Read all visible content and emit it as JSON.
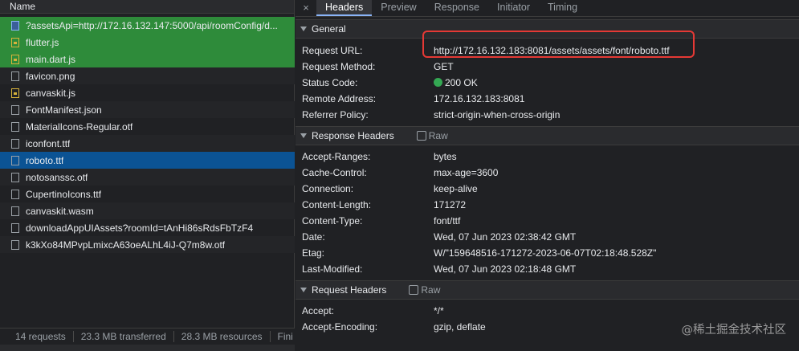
{
  "left": {
    "header": "Name",
    "requests": [
      {
        "name": "?assetsApi=http://172.16.132.147:5000/api/roomConfig/d...",
        "icon": "doc",
        "state": "green"
      },
      {
        "name": "flutter.js",
        "icon": "js",
        "state": "green"
      },
      {
        "name": "main.dart.js",
        "icon": "js",
        "state": "green"
      },
      {
        "name": "favicon.png",
        "icon": "file",
        "state": ""
      },
      {
        "name": "canvaskit.js",
        "icon": "js",
        "state": ""
      },
      {
        "name": "FontManifest.json",
        "icon": "file",
        "state": ""
      },
      {
        "name": "MaterialIcons-Regular.otf",
        "icon": "file",
        "state": ""
      },
      {
        "name": "iconfont.ttf",
        "icon": "file",
        "state": ""
      },
      {
        "name": "roboto.ttf",
        "icon": "file",
        "state": "selected"
      },
      {
        "name": "notosanssc.otf",
        "icon": "file",
        "state": ""
      },
      {
        "name": "CupertinoIcons.ttf",
        "icon": "file",
        "state": ""
      },
      {
        "name": "canvaskit.wasm",
        "icon": "file",
        "state": ""
      },
      {
        "name": "downloadAppUIAssets?roomId=tAnHi86sRdsFbTzF4",
        "icon": "file",
        "state": ""
      },
      {
        "name": "k3kXo84MPvpLmixcA63oeALhL4iJ-Q7m8w.otf",
        "icon": "file",
        "state": ""
      }
    ],
    "status": {
      "requests": "14 requests",
      "transferred": "23.3 MB transferred",
      "resources": "28.3 MB resources",
      "finish": "Fini"
    }
  },
  "tabs": {
    "close": "×",
    "items": [
      "Headers",
      "Preview",
      "Response",
      "Initiator",
      "Timing"
    ],
    "active": "Headers"
  },
  "general": {
    "title": "General",
    "rows": [
      {
        "k": "Request URL:",
        "v": "http://172.16.132.183:8081/assets/assets/font/roboto.ttf"
      },
      {
        "k": "Request Method:",
        "v": "GET"
      },
      {
        "k": "Status Code:",
        "v": "200 OK"
      },
      {
        "k": "Remote Address:",
        "v": "172.16.132.183:8081"
      },
      {
        "k": "Referrer Policy:",
        "v": "strict-origin-when-cross-origin"
      }
    ]
  },
  "response_headers": {
    "title": "Response Headers",
    "raw": "Raw",
    "rows": [
      {
        "k": "Accept-Ranges:",
        "v": "bytes"
      },
      {
        "k": "Cache-Control:",
        "v": "max-age=3600"
      },
      {
        "k": "Connection:",
        "v": "keep-alive"
      },
      {
        "k": "Content-Length:",
        "v": "171272"
      },
      {
        "k": "Content-Type:",
        "v": "font/ttf"
      },
      {
        "k": "Date:",
        "v": "Wed, 07 Jun 2023 02:38:42 GMT"
      },
      {
        "k": "Etag:",
        "v": "W/\"159648516-171272-2023-06-07T02:18:48.528Z\""
      },
      {
        "k": "Last-Modified:",
        "v": "Wed, 07 Jun 2023 02:18:48 GMT"
      }
    ]
  },
  "request_headers": {
    "title": "Request Headers",
    "raw": "Raw",
    "rows": [
      {
        "k": "Accept:",
        "v": "*/*"
      },
      {
        "k": "Accept-Encoding:",
        "v": "gzip, deflate"
      }
    ]
  },
  "watermark": "@稀土掘金技术社区",
  "colors": {
    "green_row": "#2e8b3a",
    "selected_row": "#0b5394",
    "highlight": "#e53935",
    "status_dot": "#34a853"
  }
}
